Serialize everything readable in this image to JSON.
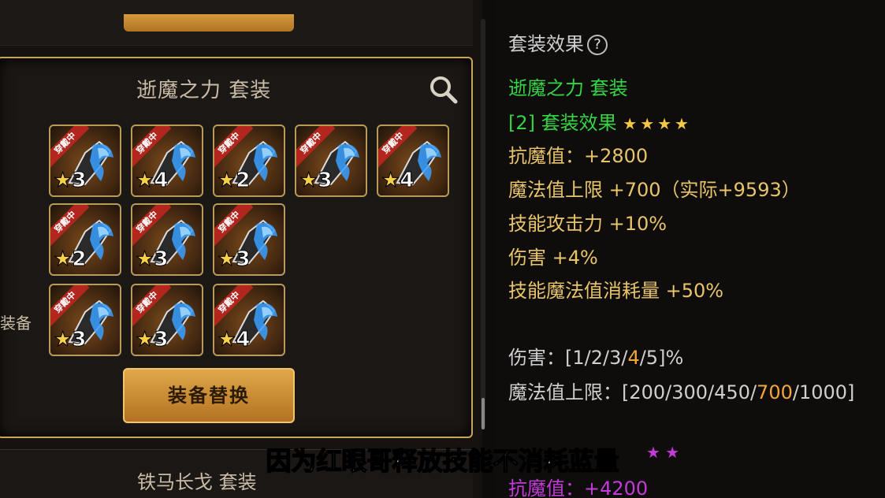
{
  "left": {
    "set_title": "逝魔之力  套装",
    "side_label": "装备",
    "swap_button": "装备替换",
    "bottom_set_title": "铁马长戈  套装",
    "items": [
      {
        "ribbon": "穿戴中",
        "stars": "3",
        "color": "#3aa0ff"
      },
      {
        "ribbon": "穿戴中",
        "stars": "4",
        "color": "#3aa0ff"
      },
      {
        "ribbon": "穿戴中",
        "stars": "2",
        "color": "#3aa0ff"
      },
      {
        "ribbon": "穿戴中",
        "stars": "3",
        "color": "#3aa0ff"
      },
      {
        "ribbon": "穿戴中",
        "stars": "4",
        "color": "#3aa0ff"
      },
      {
        "ribbon": "穿戴中",
        "stars": "2",
        "color": "#3aa0ff"
      },
      {
        "ribbon": "穿戴中",
        "stars": "3",
        "color": "#3aa0ff"
      },
      {
        "ribbon": "穿戴中",
        "stars": "3",
        "color": "#3aa0ff"
      },
      {
        "ribbon": "穿戴中",
        "stars": "3",
        "color": "#3aa0ff"
      },
      {
        "ribbon": "穿戴中",
        "stars": "3",
        "color": "#3aa0ff"
      },
      {
        "ribbon": "穿戴中",
        "stars": "4",
        "color": "#3aa0ff"
      }
    ]
  },
  "right": {
    "header": "套装效果",
    "help": "?",
    "set_name": "逝魔之力  套装",
    "effect_label": "[2] 套装效果",
    "effect_stars": "★★★★",
    "stats": [
      "抗魔值：+2800",
      "魔法值上限 +700（实际+9593）",
      "技能攻击力 +10%",
      "伤害 +4%",
      "技能魔法值消耗量 +50%"
    ],
    "damage_prefix": "伤害：[1/2/3/",
    "damage_hl": "4",
    "damage_suffix": "/5]%",
    "mana_prefix": "魔法值上限：[200/300/450/",
    "mana_hl": "700",
    "mana_suffix": "/1000]",
    "next_stars": "★ ★",
    "next_stat": "抗魔值：+4200"
  },
  "subtitle": "因为红眼哥释放技能不消耗蓝量"
}
